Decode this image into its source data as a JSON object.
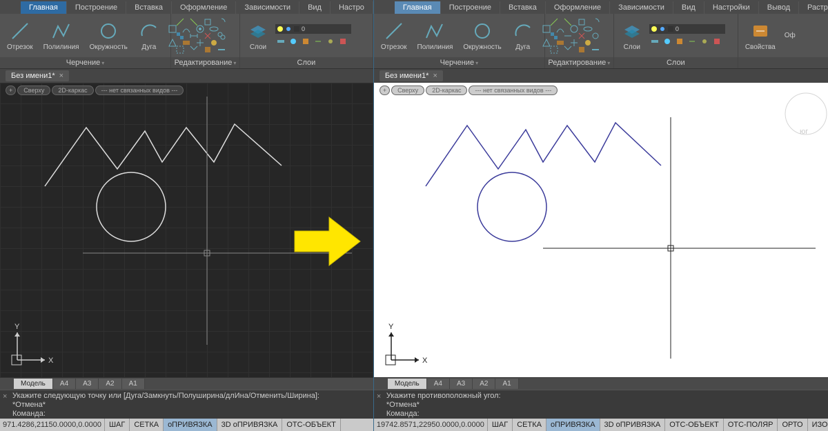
{
  "left": {
    "tabs": [
      "Главная",
      "Построение",
      "Вставка",
      "Оформление",
      "Зависимости",
      "Вид",
      "Настро"
    ],
    "activeTab": "Главная",
    "panels": {
      "draw": "Черчение",
      "edit": "Редактирование",
      "layers": "Слои"
    },
    "tools": {
      "segment": "Отрезок",
      "polyline": "Полилиния",
      "circle": "Окружность",
      "arc": "Дуга",
      "layers": "Слои"
    },
    "file": "Без имени1*",
    "viewtags": {
      "plus": "+",
      "top": "Сверху",
      "frame": "2D-каркас",
      "linked": "--- нет связанных видов ---"
    },
    "layouts": [
      "Модель",
      "A4",
      "A3",
      "A2",
      "A1"
    ],
    "cmd1": "Укажите следующую точку или [Дуга/Замкнуть/Полуширина/длИна/Отменить/Ширина]:",
    "cmd2": "*Отмена*",
    "cmd3": "Команда:",
    "coords": "971.4286,21150.0000,0.0000",
    "statusBtns": [
      "ШАГ",
      "СЕТКА",
      "оПРИВЯЗКА",
      "3D оПРИВЯЗКА",
      "ОТС-ОБЪЕКТ"
    ],
    "statusActive": "оПРИВЯЗКА"
  },
  "right": {
    "tabs": [
      "Главная",
      "Построение",
      "Вставка",
      "Оформление",
      "Зависимости",
      "Вид",
      "Настройки",
      "Вывод",
      "Растр"
    ],
    "activeTab": "Главная",
    "panels": {
      "draw": "Черчение",
      "edit": "Редактирование",
      "layers": "Слои"
    },
    "tools": {
      "segment": "Отрезок",
      "polyline": "Полилиния",
      "circle": "Окружность",
      "arc": "Дуга",
      "layers": "Слои",
      "props": "Свойства",
      "of": "Оф"
    },
    "file": "Без имени1*",
    "viewtags": {
      "plus": "+",
      "top": "Сверху",
      "frame": "2D-каркас",
      "linked": "--- нет связанных видов ---"
    },
    "layouts": [
      "Модель",
      "A4",
      "A3",
      "A2",
      "A1"
    ],
    "cmd1": "Укажите противоположный угол:",
    "cmd2": "*Отмена*",
    "cmd3": "Команда:",
    "coords": "19742.8571,22950.0000,0.0000",
    "statusBtns": [
      "ШАГ",
      "СЕТКА",
      "оПРИВЯЗКА",
      "3D оПРИВЯЗКА",
      "ОТС-ОБЪЕКТ",
      "ОТС-ПОЛЯР",
      "ОРТО",
      "ИЗО"
    ],
    "statusActive": "оПРИВЯЗКА"
  },
  "axes": {
    "x": "X",
    "y": "Y"
  }
}
